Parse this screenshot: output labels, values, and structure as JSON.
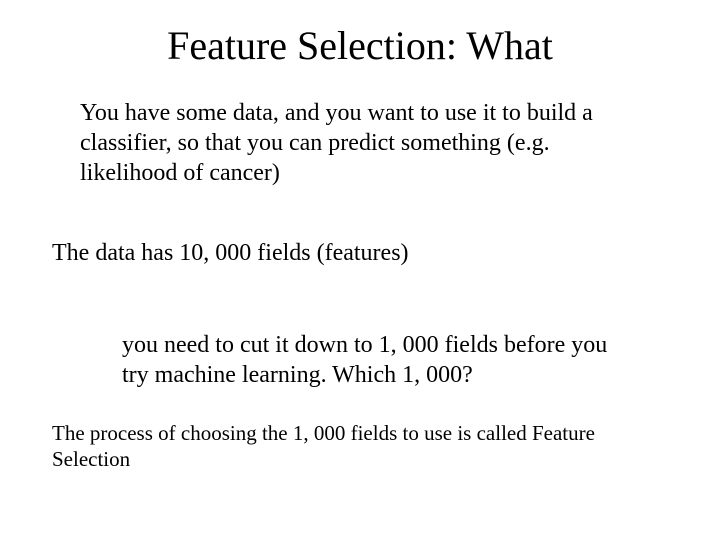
{
  "title": "Feature Selection:  What",
  "para1": "You have some data, and you want to use it to build a classifier, so that you can predict something (e.g. likelihood of cancer)",
  "para2": "The data has 10, 000 fields (features)",
  "para3": "you need to cut it down to 1, 000 fields before you try machine learning. Which 1, 000?",
  "para4": "The process of choosing the 1, 000 fields to use is called Feature Selection"
}
